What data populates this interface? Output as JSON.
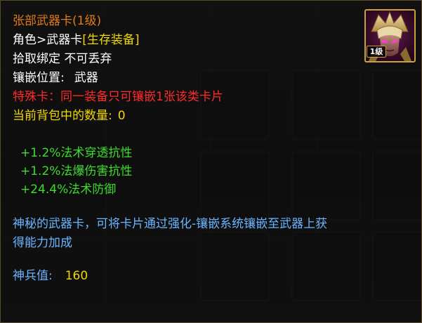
{
  "card": {
    "title": "张部武器卡(1级)",
    "type_prefix": "角色>武器卡",
    "type_tag": "[生存装备]",
    "binding": "拾取绑定 不可丢弃",
    "slot_label": "镶嵌位置:",
    "slot_value": "武器",
    "special_note": "特殊卡：同一装备只可镶嵌1张该类卡片",
    "bag_count_label": "当前背包中的数量:",
    "bag_count_value": "0",
    "stats": [
      "+1.2%法术穿透抗性",
      "+1.2%法爆伤害抗性",
      "+24.4%法术防御"
    ],
    "description_line1": "神秘的武器卡，可将卡片通过强化-镶嵌系统镶嵌至武器上获",
    "description_line2": "得能力加成",
    "divine_label": "神兵值:",
    "divine_value": "160",
    "level_badge": "1级",
    "portrait_icon": "hero-portrait-icon"
  },
  "colors": {
    "title": "#e07a1a",
    "gold": "#f0d800",
    "red": "#ff2a2a",
    "green": "#3ddc2e",
    "blue": "#6ab4ff"
  }
}
